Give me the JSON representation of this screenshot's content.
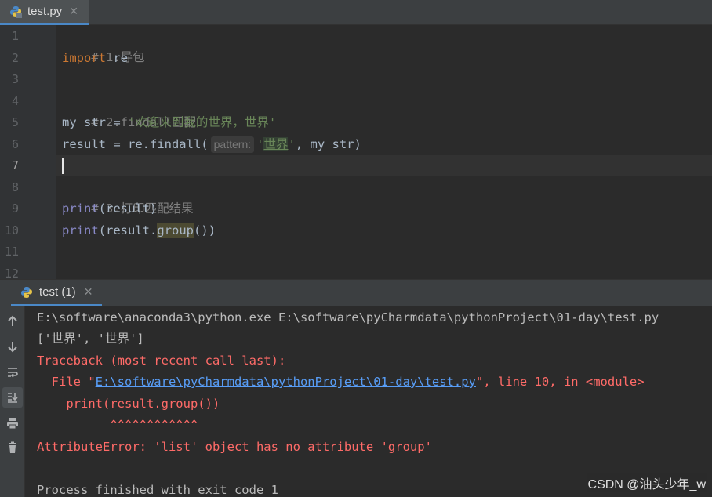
{
  "editor": {
    "tab_label": "test.py",
    "tab_close": "✕",
    "line_numbers": [
      "1",
      "2",
      "3",
      "4",
      "5",
      "6",
      "7",
      "8",
      "9",
      "10",
      "11",
      "12"
    ],
    "code": {
      "l1_comment": "# 1.导包",
      "l2_kw": "import",
      "l2_rest": " re",
      "l4_comment": "# 2.findall匹配",
      "l5_var": "my_str = ",
      "l5_str": "'欢迎来到我的世界，世界'",
      "l6_pre": "result = re.findall(",
      "l6_hint": "pattern:",
      "l6_q1": "'",
      "l6_str": "世界",
      "l6_q2": "'",
      "l6_post": ", my_str)",
      "l8_comment": "# 3.打印匹配结果",
      "l9_fn": "print",
      "l9_rest": "(result)",
      "l10_fn": "print",
      "l10_mid": "(result.",
      "l10_hl": "group",
      "l10_end": "())"
    }
  },
  "run": {
    "tab_label": "test (1)",
    "tab_close": "✕",
    "sidebar_icons": [
      "arrow-up-icon",
      "arrow-down-icon",
      "soft-wrap-icon",
      "scroll-to-end-icon",
      "print-icon",
      "trash-icon"
    ],
    "console": {
      "cmd": "E:\\software\\anaconda3\\python.exe E:\\software\\pyCharmdata\\pythonProject\\01-day\\test.py",
      "out1": "['世界', '世界']",
      "tb_head": "Traceback (most recent call last):",
      "file_pre": "  File \"",
      "file_link": "E:\\software\\pyCharmdata\\pythonProject\\01-day\\test.py",
      "file_post": "\", line 10, in <module>",
      "src_line": "    print(result.group())",
      "carets": "          ^^^^^^^^^^^^",
      "error": "AttributeError: 'list' object has no attribute 'group'",
      "exit": "Process finished with exit code 1"
    }
  },
  "watermark": "CSDN @油头少年_w",
  "colors": {
    "background": "#2b2b2b",
    "keyword": "#cc7832",
    "string": "#6a8759",
    "builtin": "#8888c6",
    "comment": "#808080",
    "error": "#ff6b68",
    "link": "#589df6",
    "accent": "#4a88c7"
  }
}
